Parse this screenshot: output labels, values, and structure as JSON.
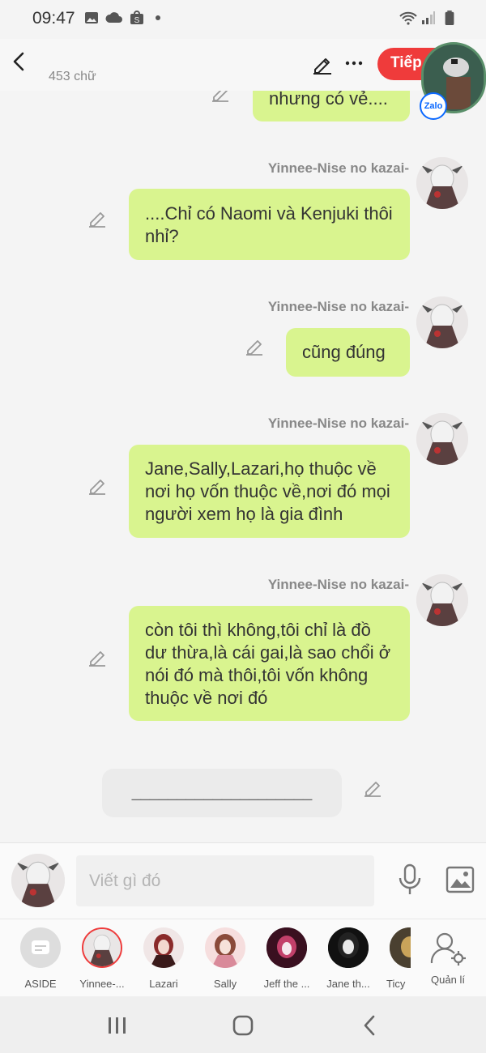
{
  "status_bar": {
    "time": "09:47"
  },
  "header": {
    "word_count": "453 chữ",
    "next_label": "Tiếp",
    "zalo_label": "Zalo"
  },
  "messages": [
    {
      "sender": "",
      "text": "nhưng có vẻ...."
    },
    {
      "sender": "Yinnee-Nise no kazai-",
      "text": "....Chỉ có Naomi và Kenjuki thôi nhỉ?"
    },
    {
      "sender": "Yinnee-Nise no kazai-",
      "text": "cũng đúng"
    },
    {
      "sender": "Yinnee-Nise no kazai-",
      "text": "Jane,Sally,Lazari,họ thuộc về nơi họ vốn thuộc về,nơi đó mọi người xem họ là gia đình"
    },
    {
      "sender": "Yinnee-Nise no kazai-",
      "text": "còn tôi thì không,tôi chỉ là đồ dư thừa,là cái gai,là sao chổi ở nói đó mà thôi,tôi vốn không thuộc về nơi đó"
    }
  ],
  "divider": {
    "text": "____________________"
  },
  "composer": {
    "placeholder": "Viết gì đó"
  },
  "characters": [
    {
      "label": "ASIDE"
    },
    {
      "label": "Yinnee-..."
    },
    {
      "label": "Lazari"
    },
    {
      "label": "Sally"
    },
    {
      "label": "Jeff the ..."
    },
    {
      "label": "Jane th..."
    },
    {
      "label": "Ticy"
    },
    {
      "label": "Quản lí"
    }
  ],
  "colors": {
    "accent": "#ef3b3b",
    "bubble": "#d9f48f",
    "zalo": "#0a68ff"
  }
}
